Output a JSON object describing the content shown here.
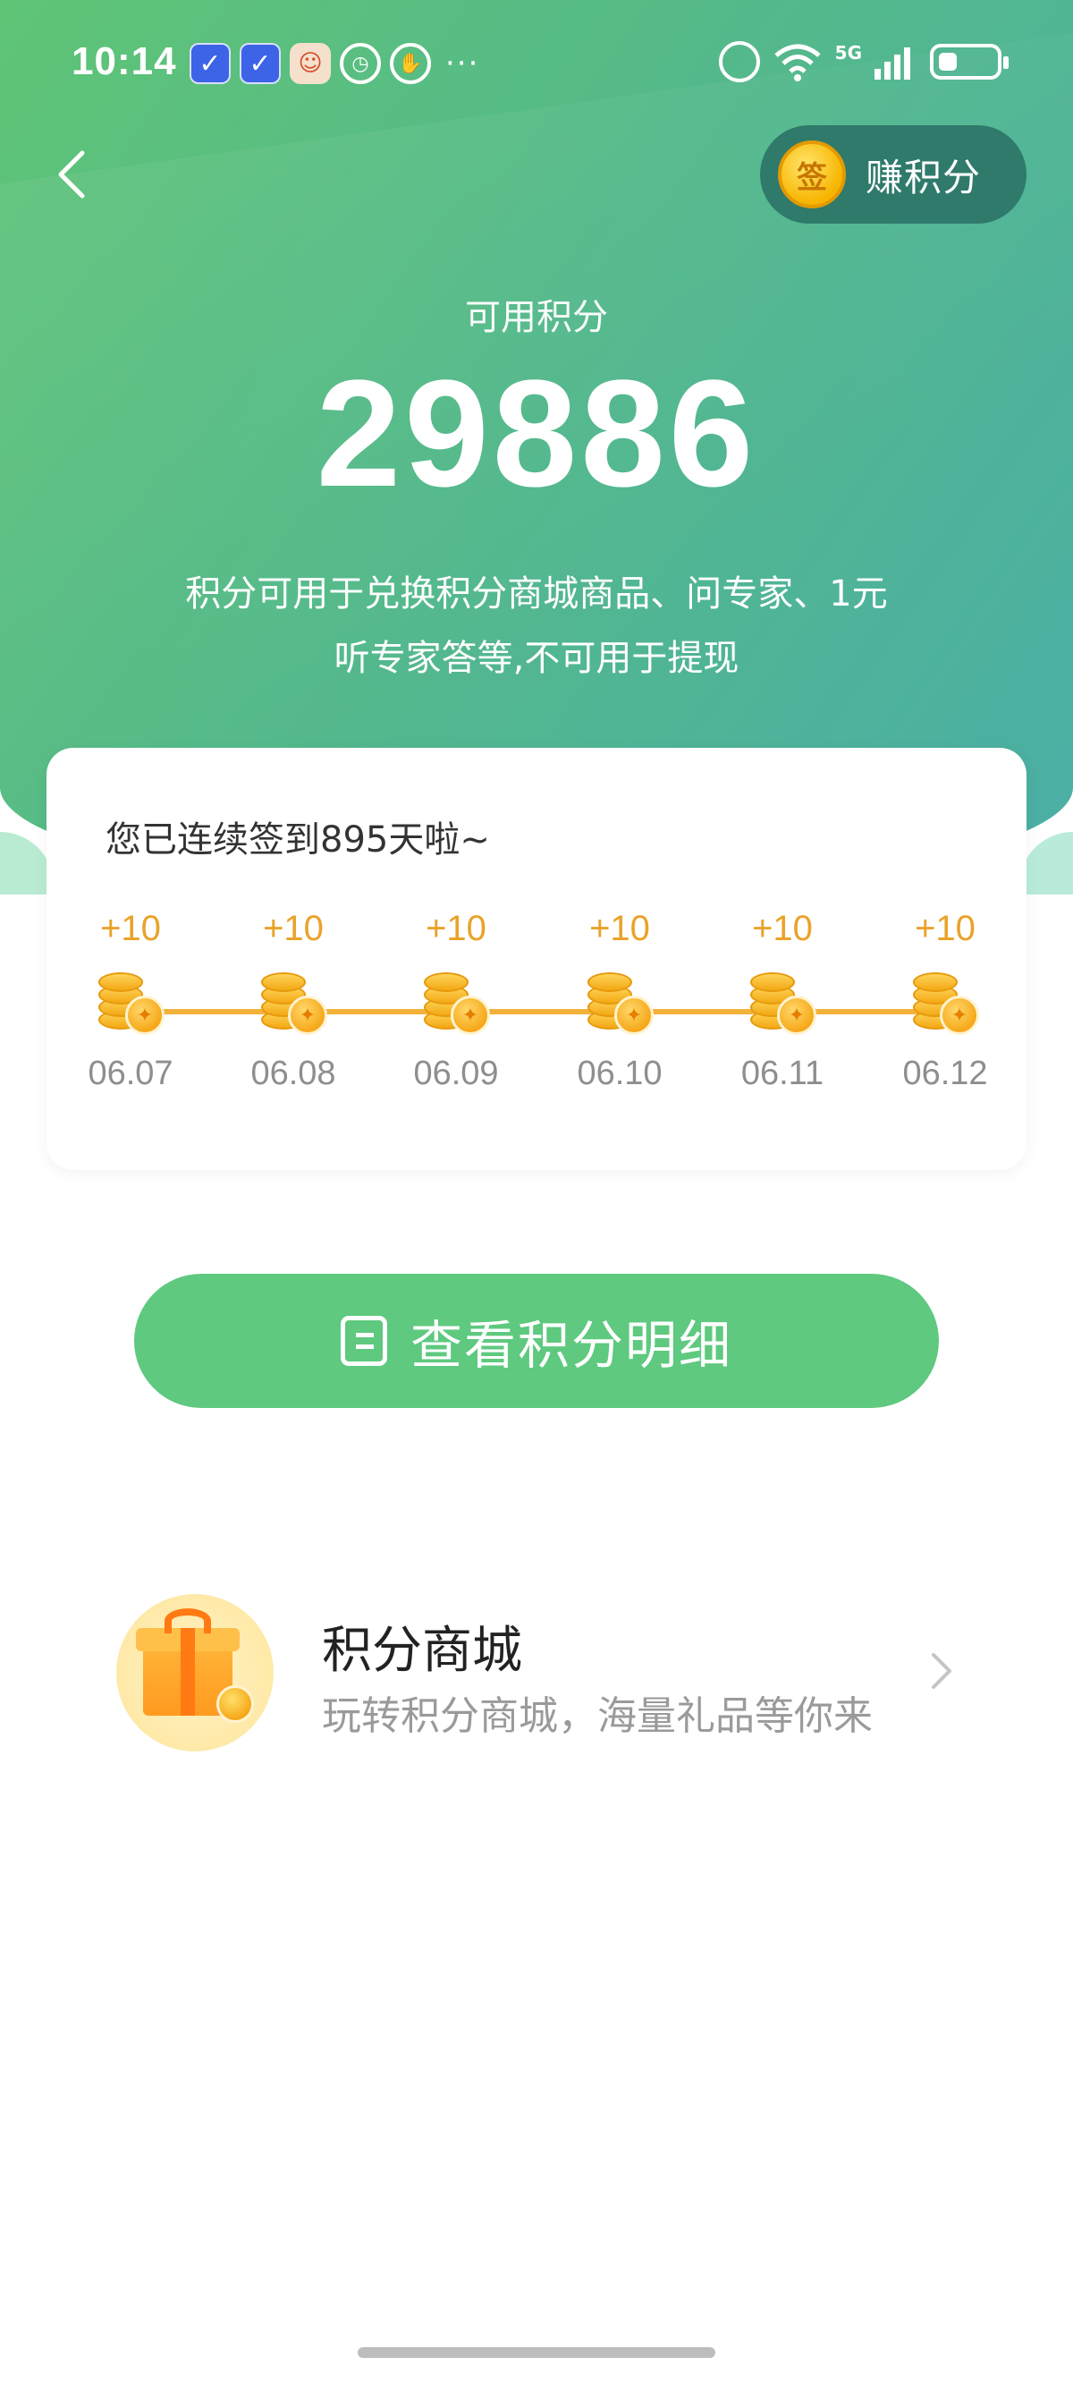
{
  "status_bar": {
    "time": "10:14",
    "dots": "···",
    "network": "5G"
  },
  "header": {
    "back_icon": "chevron-left-icon",
    "earn_button": {
      "coin_text": "签",
      "label": "赚积分"
    }
  },
  "points": {
    "caption": "可用积分",
    "value": "29886",
    "description_line1": "积分可用于兑换积分商城商品、问专家、1元",
    "description_line2": "听专家答等,不可用于提现"
  },
  "signin": {
    "streak_text": "您已连续签到895天啦~",
    "days": [
      {
        "points": "+10",
        "date": "06.07"
      },
      {
        "points": "+10",
        "date": "06.08"
      },
      {
        "points": "+10",
        "date": "06.09"
      },
      {
        "points": "+10",
        "date": "06.10"
      },
      {
        "points": "+10",
        "date": "06.11"
      },
      {
        "points": "+10",
        "date": "06.12"
      }
    ]
  },
  "details_button": {
    "label": "查看积分明细"
  },
  "mall": {
    "title": "积分商城",
    "subtitle": "玩转积分商城，海量礼品等你来",
    "icon": "gift-icon"
  },
  "colors": {
    "header_start": "#5fc476",
    "header_end": "#4aaea6",
    "accent_green": "#5ec97f",
    "coin_gold": "#f2b23a",
    "earn_button_bg": "#2f7a6b"
  }
}
